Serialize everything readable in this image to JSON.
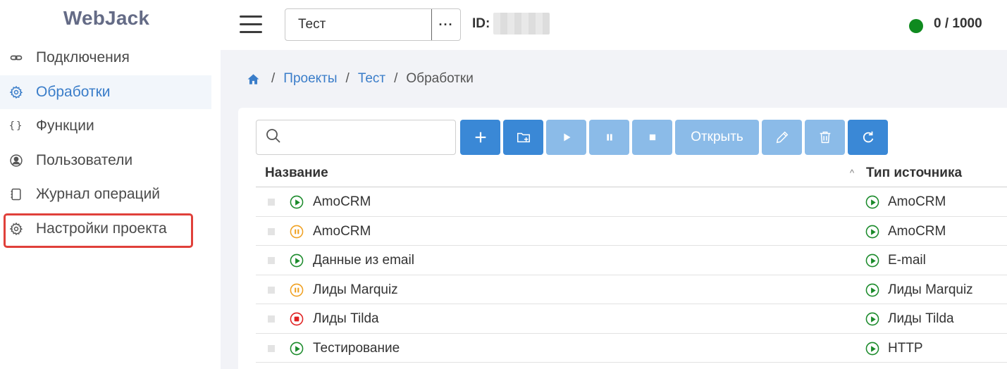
{
  "sidebar": {
    "logo": "WebJack",
    "items": [
      {
        "label": "Подключения",
        "icon": "link-icon",
        "active": false
      },
      {
        "label": "Обработки",
        "icon": "gear-icon",
        "active": true
      },
      {
        "label": "Функции",
        "icon": "braces-icon",
        "active": false
      },
      {
        "label": "Пользователи",
        "icon": "user-icon",
        "active": false
      },
      {
        "label": "Журнал операций",
        "icon": "journal-icon",
        "active": false
      },
      {
        "label": "Настройки проекта",
        "icon": "gear-icon",
        "active": false
      }
    ]
  },
  "topbar": {
    "project_name": "Тест",
    "more_label": "···",
    "id_label": "ID:",
    "counter": "0 / 1000",
    "status_color": "#0f8a1f"
  },
  "breadcrumb": {
    "items": [
      "Проекты",
      "Тест",
      "Обработки"
    ]
  },
  "toolbar": {
    "search_placeholder": "",
    "open_label": "Открыть"
  },
  "table": {
    "columns": {
      "name": "Название",
      "source": "Тип источника"
    },
    "sort_indicator": "^",
    "rows": [
      {
        "name": "AmoCRM",
        "status": "running",
        "source": "AmoCRM"
      },
      {
        "name": "AmoCRM",
        "status": "paused",
        "source": "AmoCRM"
      },
      {
        "name": "Данные из email",
        "status": "running",
        "source": "E-mail"
      },
      {
        "name": "Лиды Marquiz",
        "status": "paused",
        "source": "Лиды Marquiz"
      },
      {
        "name": "Лиды Tilda",
        "status": "stopped",
        "source": "Лиды Tilda"
      },
      {
        "name": "Тестирование",
        "status": "running",
        "source": "HTTP"
      }
    ]
  },
  "colors": {
    "accent": "#3a88d6",
    "running": "#1a8a2a",
    "paused": "#f0a020",
    "stopped": "#e02020"
  }
}
